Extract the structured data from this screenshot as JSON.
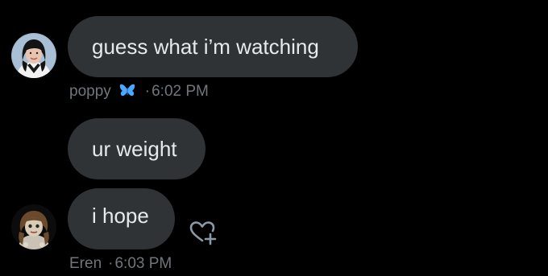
{
  "messages": [
    {
      "text": "guess what i’m watching",
      "sender": "poppy",
      "sender_badge_icon": "butterfly-icon",
      "separator": "·",
      "time": "6:02 PM"
    },
    {
      "text": "ur weight"
    },
    {
      "text": "i hope",
      "sender": "Eren",
      "separator": "·",
      "time": "6:03 PM",
      "reaction_icon": "add-reaction-heart-icon"
    }
  ],
  "colors": {
    "background": "#000000",
    "bubble": "#2f3336",
    "text": "#e7e9ea",
    "meta": "#71767b",
    "butterfly": "#4aa8ff"
  }
}
